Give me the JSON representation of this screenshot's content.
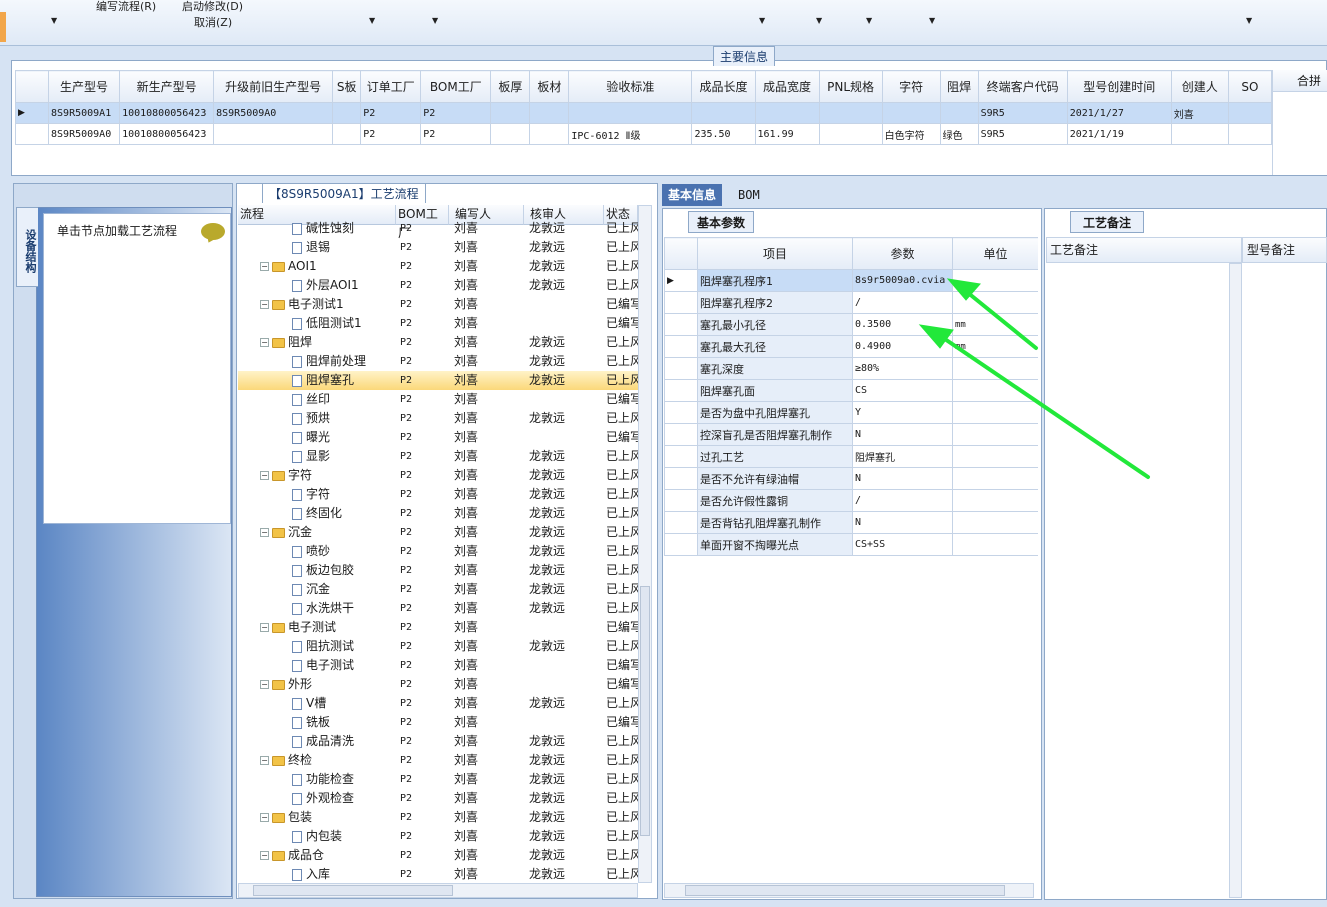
{
  "toolbar": {
    "item1": "编写流程(R)",
    "item2": "启动修改(D)",
    "item3": "取消(Z)"
  },
  "main_info": {
    "title": "主要信息",
    "columns": [
      "生产型号",
      "新生产型号",
      "升级前旧生产型号",
      "S板",
      "订单工厂",
      "BOM工厂",
      "板厚",
      "板材",
      "验收标准",
      "成品长度",
      "成品宽度",
      "PNL规格",
      "字符",
      "阻焊",
      "终端客户代码",
      "型号创建时间",
      "创建人",
      "SO"
    ],
    "right_header": "合拼",
    "rows": [
      [
        "8S9R5009A1",
        "10010800056423",
        "8S9R5009A0",
        "",
        "P2",
        "P2",
        "",
        "",
        "",
        "",
        "",
        "",
        "",
        "",
        "S9R5",
        "2021/1/27",
        "刘喜",
        ""
      ],
      [
        "8S9R5009A0",
        "10010800056423",
        "",
        "",
        "P2",
        "P2",
        "",
        "",
        "IPC-6012 Ⅱ级",
        "235.50",
        "161.99",
        "",
        "白色字符",
        "绿色",
        "S9R5",
        "2021/1/19",
        "",
        ""
      ]
    ]
  },
  "left": {
    "vtab": "设备结构",
    "hint": "单击节点加载工艺流程"
  },
  "process": {
    "title": "【8S9R5009A1】工艺流程",
    "columns": [
      "流程",
      "BOM工厂",
      "编写人",
      "核审人",
      "状态"
    ],
    "rows": [
      {
        "name": "碱性蚀刻",
        "level": 1,
        "bom": "P2",
        "writer": "刘喜",
        "reviewer": "龙敦远",
        "status": "已上风"
      },
      {
        "name": "退锡",
        "level": 1,
        "bom": "P2",
        "writer": "刘喜",
        "reviewer": "龙敦远",
        "status": "已上风"
      },
      {
        "name": "AOI1",
        "level": 0,
        "bom": "P2",
        "writer": "刘喜",
        "reviewer": "龙敦远",
        "status": "已上风"
      },
      {
        "name": "外层AOI1",
        "level": 1,
        "bom": "P2",
        "writer": "刘喜",
        "reviewer": "龙敦远",
        "status": "已上风"
      },
      {
        "name": "电子测试1",
        "level": 0,
        "bom": "P2",
        "writer": "刘喜",
        "reviewer": "",
        "status": "已编写"
      },
      {
        "name": "低阻测试1",
        "level": 1,
        "bom": "P2",
        "writer": "刘喜",
        "reviewer": "",
        "status": "已编写"
      },
      {
        "name": "阻焊",
        "level": 0,
        "bom": "P2",
        "writer": "刘喜",
        "reviewer": "龙敦远",
        "status": "已上风"
      },
      {
        "name": "阻焊前处理",
        "level": 1,
        "bom": "P2",
        "writer": "刘喜",
        "reviewer": "龙敦远",
        "status": "已上风"
      },
      {
        "name": "阻焊塞孔",
        "level": 1,
        "bom": "P2",
        "writer": "刘喜",
        "reviewer": "龙敦远",
        "status": "已上风",
        "hl": true
      },
      {
        "name": "丝印",
        "level": 1,
        "bom": "P2",
        "writer": "刘喜",
        "reviewer": "",
        "status": "已编写"
      },
      {
        "name": "预烘",
        "level": 1,
        "bom": "P2",
        "writer": "刘喜",
        "reviewer": "龙敦远",
        "status": "已上风"
      },
      {
        "name": "曝光",
        "level": 1,
        "bom": "P2",
        "writer": "刘喜",
        "reviewer": "",
        "status": "已编写"
      },
      {
        "name": "显影",
        "level": 1,
        "bom": "P2",
        "writer": "刘喜",
        "reviewer": "龙敦远",
        "status": "已上风"
      },
      {
        "name": "字符",
        "level": 0,
        "bom": "P2",
        "writer": "刘喜",
        "reviewer": "龙敦远",
        "status": "已上风"
      },
      {
        "name": "字符",
        "level": 1,
        "bom": "P2",
        "writer": "刘喜",
        "reviewer": "龙敦远",
        "status": "已上风"
      },
      {
        "name": "终固化",
        "level": 1,
        "bom": "P2",
        "writer": "刘喜",
        "reviewer": "龙敦远",
        "status": "已上风"
      },
      {
        "name": "沉金",
        "level": 0,
        "bom": "P2",
        "writer": "刘喜",
        "reviewer": "龙敦远",
        "status": "已上风"
      },
      {
        "name": "喷砂",
        "level": 1,
        "bom": "P2",
        "writer": "刘喜",
        "reviewer": "龙敦远",
        "status": "已上风"
      },
      {
        "name": "板边包胶",
        "level": 1,
        "bom": "P2",
        "writer": "刘喜",
        "reviewer": "龙敦远",
        "status": "已上风"
      },
      {
        "name": "沉金",
        "level": 1,
        "bom": "P2",
        "writer": "刘喜",
        "reviewer": "龙敦远",
        "status": "已上风"
      },
      {
        "name": "水洗烘干",
        "level": 1,
        "bom": "P2",
        "writer": "刘喜",
        "reviewer": "龙敦远",
        "status": "已上风"
      },
      {
        "name": "电子测试",
        "level": 0,
        "bom": "P2",
        "writer": "刘喜",
        "reviewer": "",
        "status": "已编写"
      },
      {
        "name": "阻抗测试",
        "level": 1,
        "bom": "P2",
        "writer": "刘喜",
        "reviewer": "龙敦远",
        "status": "已上风"
      },
      {
        "name": "电子测试",
        "level": 1,
        "bom": "P2",
        "writer": "刘喜",
        "reviewer": "",
        "status": "已编写"
      },
      {
        "name": "外形",
        "level": 0,
        "bom": "P2",
        "writer": "刘喜",
        "reviewer": "",
        "status": "已编写"
      },
      {
        "name": "V槽",
        "level": 1,
        "bom": "P2",
        "writer": "刘喜",
        "reviewer": "龙敦远",
        "status": "已上风"
      },
      {
        "name": "铣板",
        "level": 1,
        "bom": "P2",
        "writer": "刘喜",
        "reviewer": "",
        "status": "已编写"
      },
      {
        "name": "成品清洗",
        "level": 1,
        "bom": "P2",
        "writer": "刘喜",
        "reviewer": "龙敦远",
        "status": "已上风"
      },
      {
        "name": "终检",
        "level": 0,
        "bom": "P2",
        "writer": "刘喜",
        "reviewer": "龙敦远",
        "status": "已上风"
      },
      {
        "name": "功能检查",
        "level": 1,
        "bom": "P2",
        "writer": "刘喜",
        "reviewer": "龙敦远",
        "status": "已上风"
      },
      {
        "name": "外观检查",
        "level": 1,
        "bom": "P2",
        "writer": "刘喜",
        "reviewer": "龙敦远",
        "status": "已上风"
      },
      {
        "name": "包装",
        "level": 0,
        "bom": "P2",
        "writer": "刘喜",
        "reviewer": "龙敦远",
        "status": "已上风"
      },
      {
        "name": "内包装",
        "level": 1,
        "bom": "P2",
        "writer": "刘喜",
        "reviewer": "龙敦远",
        "status": "已上风"
      },
      {
        "name": "成品仓",
        "level": 0,
        "bom": "P2",
        "writer": "刘喜",
        "reviewer": "龙敦远",
        "status": "已上风"
      },
      {
        "name": "入库",
        "level": 1,
        "bom": "P2",
        "writer": "刘喜",
        "reviewer": "龙敦远",
        "status": "已上风"
      }
    ]
  },
  "detail": {
    "tabs": [
      "基本信息",
      "BOM"
    ],
    "sub_tab": "基本参数",
    "columns": [
      "项目",
      "参数",
      "单位"
    ],
    "params": [
      [
        "阻焊塞孔程序1",
        "8s9r5009a0.cvia",
        ""
      ],
      [
        "阻焊塞孔程序2",
        "/",
        ""
      ],
      [
        "塞孔最小孔径",
        "0.3500",
        "mm"
      ],
      [
        "塞孔最大孔径",
        "0.4900",
        "mm"
      ],
      [
        "塞孔深度",
        "≥80%",
        ""
      ],
      [
        "阻焊塞孔面",
        "CS",
        ""
      ],
      [
        "是否为盘中孔阻焊塞孔",
        "Y",
        ""
      ],
      [
        "控深盲孔是否阻焊塞孔制作",
        "N",
        ""
      ],
      [
        "过孔工艺",
        "阻焊塞孔",
        ""
      ],
      [
        "是否不允许有绿油帽",
        "N",
        ""
      ],
      [
        "是否允许假性露铜",
        "/",
        ""
      ],
      [
        "是否背钻孔阻焊塞孔制作",
        "N",
        ""
      ],
      [
        "单面开窗不掏曝光点",
        "CS+SS",
        ""
      ]
    ],
    "notes_tab": "工艺备注",
    "notes_col1": "工艺备注",
    "notes_col2": "型号备注"
  },
  "colors": {
    "arrow": "#22e83a",
    "highlight": "#fbd87a",
    "selected_row": "#c7dcf6"
  }
}
